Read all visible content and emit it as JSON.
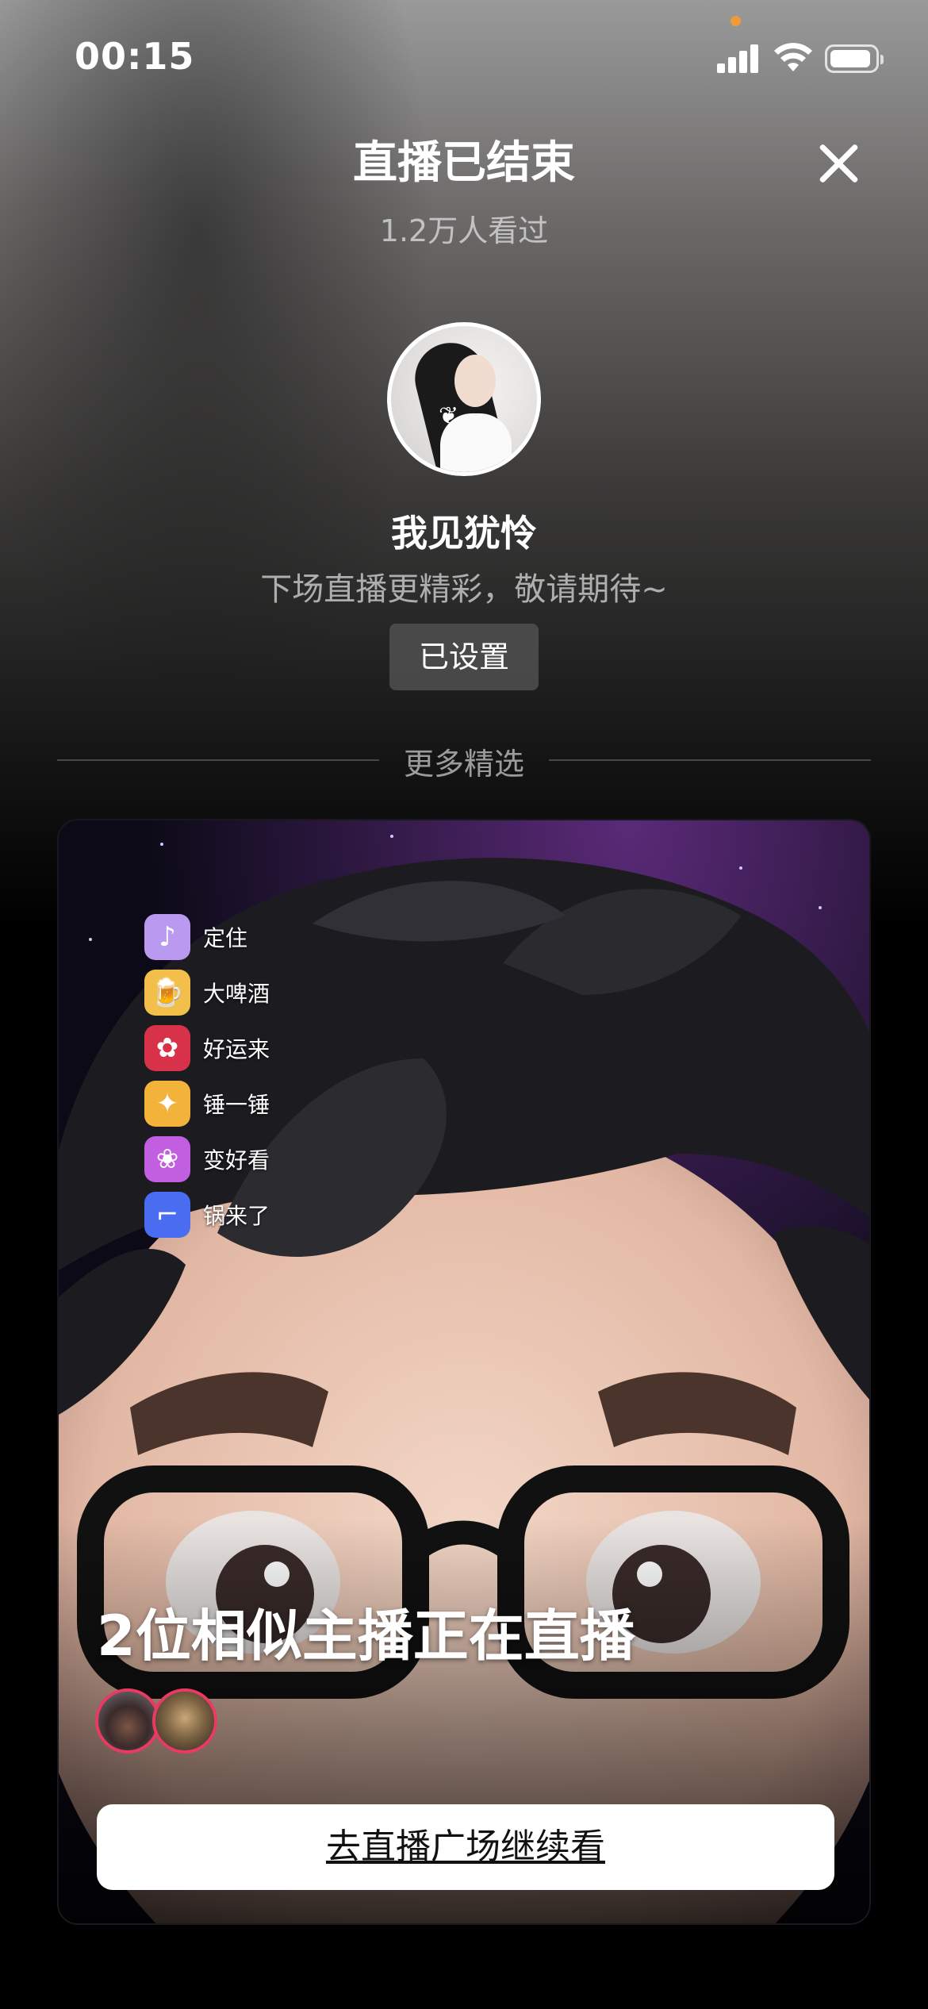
{
  "status_bar": {
    "time": "00:15",
    "icons": [
      "signal-icon",
      "wifi-icon",
      "battery-icon"
    ],
    "indicator_color": "#f29a3a"
  },
  "header": {
    "title": "直播已结束",
    "viewers": "1.2万人看过",
    "close_icon": "close-icon"
  },
  "anchor": {
    "name": "我见犹怜",
    "subtitle": "下场直播更精彩，敬请期待~",
    "reminder_button": "已设置"
  },
  "section": {
    "label": "更多精选"
  },
  "card": {
    "gifts": [
      {
        "icon": "music-note-icon",
        "glyph": "♪",
        "bg": "#b99af0",
        "label": "定住"
      },
      {
        "icon": "beer-icon",
        "glyph": "🍺",
        "bg": "#f2c04a",
        "label": "大啤酒"
      },
      {
        "icon": "flower-bouquet-icon",
        "glyph": "✿",
        "bg": "#d8324a",
        "label": "好运来"
      },
      {
        "icon": "hammer-duck-icon",
        "glyph": "✦",
        "bg": "#f3b23a",
        "label": "锤一锤"
      },
      {
        "icon": "makeup-icon",
        "glyph": "❀",
        "bg": "#c25ee0",
        "label": "变好看"
      },
      {
        "icon": "sunglasses-icon",
        "glyph": "⌐",
        "bg": "#4a6cf0",
        "label": "锅来了"
      }
    ],
    "headline": "2位相似主播正在直播",
    "cta_button": "去直播广场继续看",
    "accent_color": "#e83a63"
  }
}
